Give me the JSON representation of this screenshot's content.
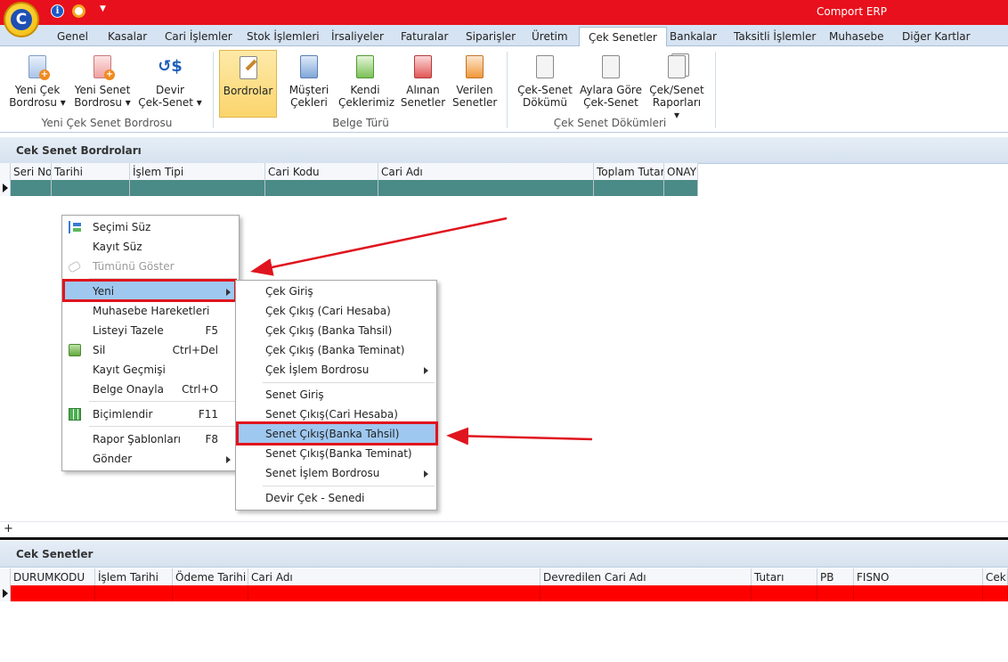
{
  "window": {
    "title": "Comport ERP",
    "logo_letter": "C"
  },
  "tabs": [
    {
      "label": "Genel"
    },
    {
      "label": "Kasalar"
    },
    {
      "label": "Cari İşlemler"
    },
    {
      "label": "Stok İşlemleri"
    },
    {
      "label": "İrsaliyeler"
    },
    {
      "label": "Faturalar"
    },
    {
      "label": "Siparişler"
    },
    {
      "label": "Üretim"
    },
    {
      "label": "Çek Senetler"
    },
    {
      "label": "Bankalar"
    },
    {
      "label": "Taksitli İşlemler"
    },
    {
      "label": "Muhasebe"
    },
    {
      "label": "Diğer Kartlar"
    }
  ],
  "active_tab": "Çek Senetler",
  "ribbon": {
    "buttons": [
      {
        "line1": "Yeni Çek",
        "line2": "Bordrosu ▾"
      },
      {
        "line1": "Yeni Senet",
        "line2": "Bordrosu ▾"
      },
      {
        "line1": "Devir",
        "line2": "Çek-Senet ▾"
      },
      {
        "line1": "Bordrolar",
        "line2": ""
      },
      {
        "line1": "Müşteri",
        "line2": "Çekleri"
      },
      {
        "line1": "Kendi",
        "line2": "Çeklerimiz"
      },
      {
        "line1": "Alınan",
        "line2": "Senetler"
      },
      {
        "line1": "Verilen",
        "line2": "Senetler"
      },
      {
        "line1": "Çek-Senet",
        "line2": "Dökümü"
      },
      {
        "line1": "Aylara Göre",
        "line2": "Çek-Senet"
      },
      {
        "line1": "Çek/Senet",
        "line2": "Raporları ▾"
      }
    ],
    "groups": [
      {
        "label": "Yeni Çek Senet Bordrosu"
      },
      {
        "label": "Belge Türü"
      },
      {
        "label": "Çek Senet Dökümleri"
      }
    ]
  },
  "bordro_panel": {
    "title": "Cek Senet Bordroları",
    "columns": [
      "Seri No",
      "Tarihi",
      "İşlem Tipi",
      "Cari Kodu",
      "Cari Adı",
      "Toplam Tutar",
      "ONAY"
    ],
    "row_color": "#4a8a87",
    "footer_symbol": "+"
  },
  "senet_panel": {
    "title": "Cek Senetler",
    "columns": [
      "DURUMKODU",
      "İşlem Tarihi",
      "Ödeme Tarihi",
      "Cari Adı",
      "Devredilen Cari Adı",
      "Tutarı",
      "PB",
      "FISNO",
      "CekK"
    ],
    "row_color": "#ff0000"
  },
  "context_menu": {
    "items": [
      {
        "label": "Seçimi Süz",
        "shortcut": "",
        "icon": "filter-tree-icon"
      },
      {
        "label": "Kayıt Süz",
        "shortcut": ""
      },
      {
        "label": "Tümünü Göster",
        "shortcut": "",
        "disabled": true,
        "icon": "eraser-icon"
      },
      {
        "label": "Yeni",
        "shortcut": "",
        "submenu": true
      },
      {
        "label": "Muhasebe Hareketleri",
        "shortcut": ""
      },
      {
        "label": "Listeyi Tazele",
        "shortcut": "F5"
      },
      {
        "label": "Sil",
        "shortcut": "Ctrl+Del",
        "icon": "delete-icon"
      },
      {
        "label": "Kayıt Geçmişi",
        "shortcut": ""
      },
      {
        "label": "Belge Onayla",
        "shortcut": "Ctrl+O"
      },
      {
        "label": "Biçimlendir",
        "shortcut": "F11",
        "icon": "format-grid-icon"
      },
      {
        "label": "Rapor Şablonları",
        "shortcut": "F8"
      },
      {
        "label": "Gönder",
        "shortcut": "",
        "submenu": true
      }
    ]
  },
  "submenu_yeni": {
    "items": [
      {
        "label": "Çek Giriş"
      },
      {
        "label": "Çek Çıkış (Cari Hesaba)"
      },
      {
        "label": "Çek Çıkış (Banka Tahsil)"
      },
      {
        "label": "Çek Çıkış (Banka Teminat)"
      },
      {
        "label": "Çek İşlem Bordrosu",
        "submenu": true
      },
      {
        "label": "Senet Giriş"
      },
      {
        "label": "Senet Çıkış(Cari Hesaba)"
      },
      {
        "label": "Senet Çıkış(Banka Tahsil)"
      },
      {
        "label": "Senet Çıkış(Banka Teminat)"
      },
      {
        "label": "Senet İşlem Bordrosu",
        "submenu": true
      },
      {
        "label": "Devir Çek - Senedi"
      }
    ]
  },
  "colors": {
    "title_bar": "#e8101c",
    "highlight": "#9fc8f0",
    "annotation_red": "#e0141e"
  }
}
